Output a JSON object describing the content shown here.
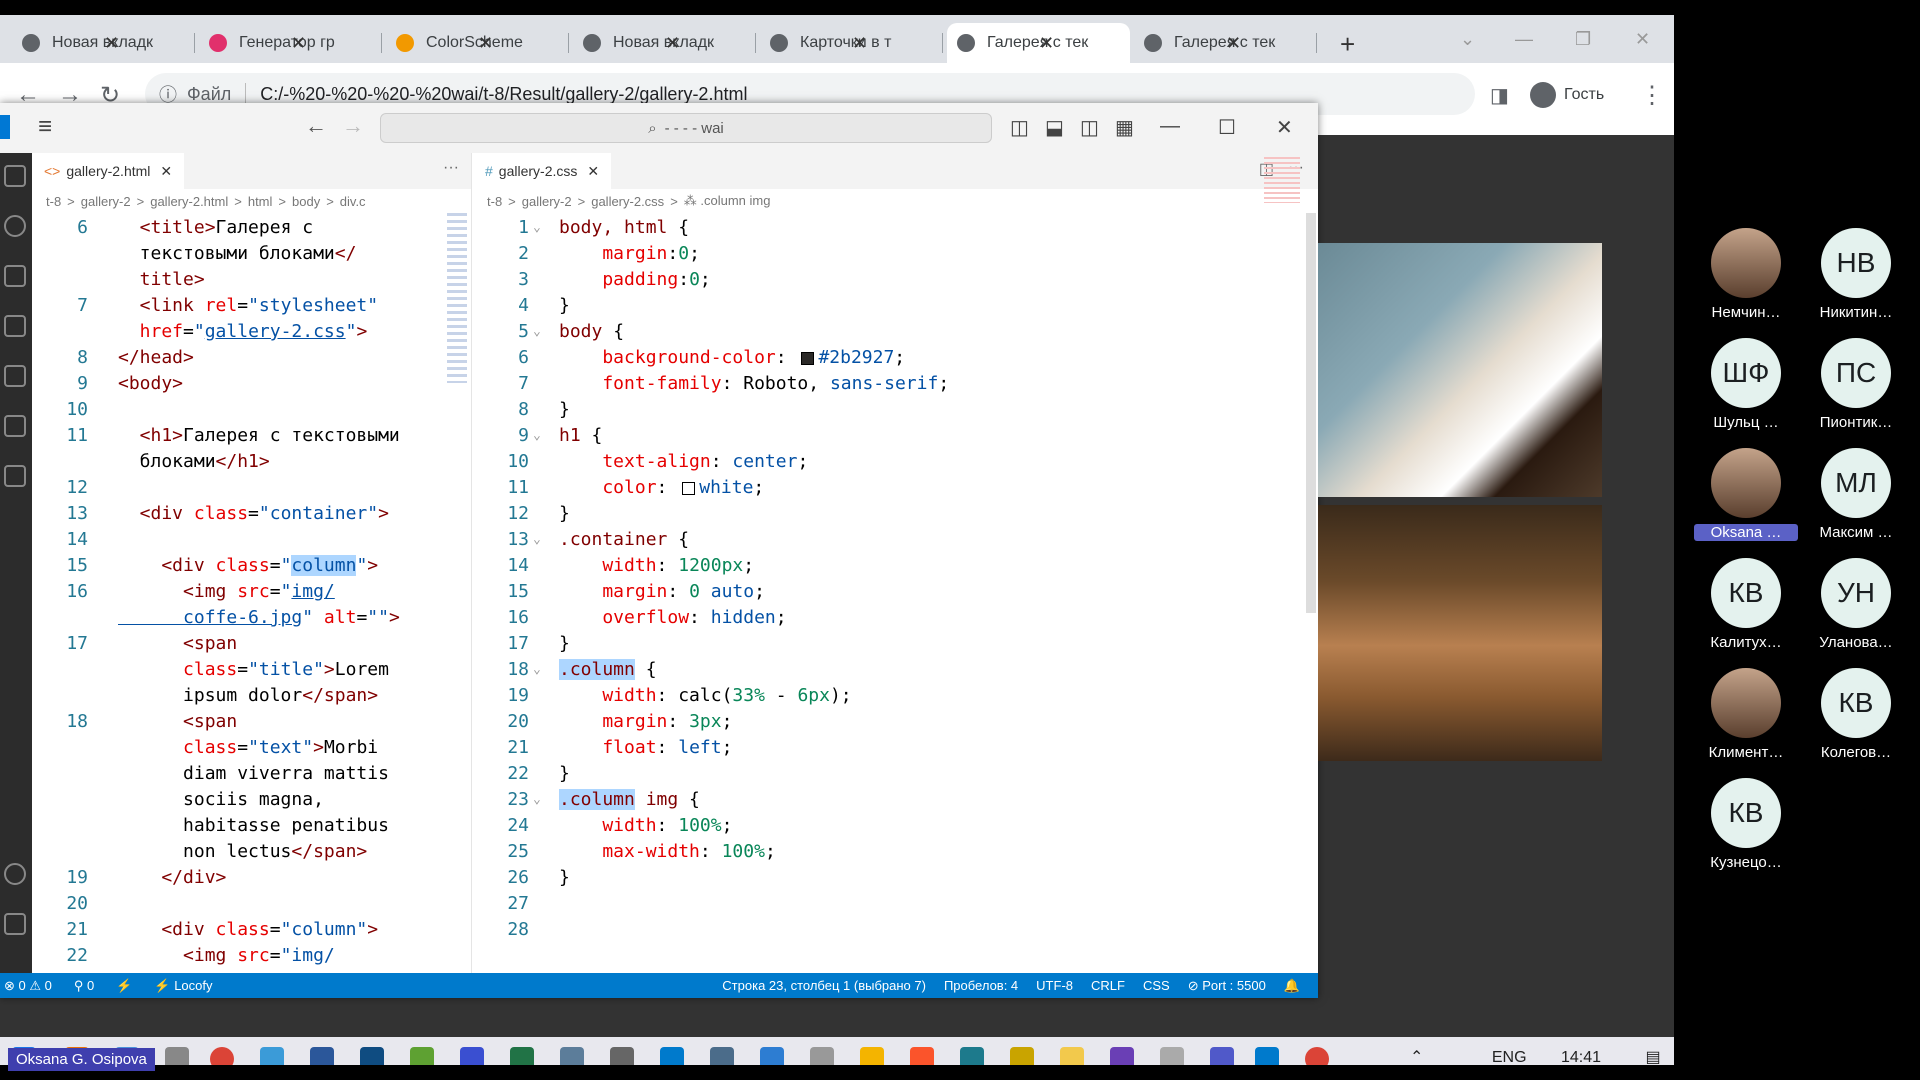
{
  "browser": {
    "tabs": [
      {
        "title": "Новая вкладк",
        "color": "#5f6368"
      },
      {
        "title": "Генератор гр",
        "color": "#e1306c"
      },
      {
        "title": "ColorScheme",
        "color": "#f29900"
      },
      {
        "title": "Новая вкладк",
        "color": "#5f6368"
      },
      {
        "title": "Карточки в т",
        "color": "#5f6368"
      },
      {
        "title": "Галерея с тек",
        "color": "#5f6368"
      },
      {
        "title": "Галерея с тек",
        "color": "#5f6368"
      }
    ],
    "active_tab": 5,
    "new_tab": "+",
    "address_label": "Файл",
    "address": "C:/-%20-%20-%20-%20wai/t-8/Result/gallery-2/gallery-2.html",
    "profile": "Гость"
  },
  "editor": {
    "search": "- - - - wai",
    "left_tab": "gallery-2.html",
    "right_tab": "gallery-2.css",
    "left_breadcrumb": [
      "t-8",
      ">",
      "gallery-2",
      ">",
      "gallery-2.html",
      ">",
      "html",
      ">",
      "body",
      ">",
      "div.c"
    ],
    "right_breadcrumb": [
      "t-8",
      ">",
      "gallery-2",
      ">",
      "gallery-2.css",
      ">",
      "⁂ .column img"
    ],
    "left_code": [
      {
        "n": "6",
        "p": [
          [
            "t-tag",
            "  <title>"
          ],
          [
            "t-text",
            "Галерея с"
          ]
        ]
      },
      {
        "n": "",
        "p": [
          [
            "t-text",
            "  текстовыми блоками"
          ],
          [
            "t-tag",
            "</"
          ]
        ]
      },
      {
        "n": "",
        "p": [
          [
            "t-tag",
            "  title>"
          ]
        ]
      },
      {
        "n": "7",
        "p": [
          [
            "t-tag",
            "  <link "
          ],
          [
            "t-attr",
            "rel"
          ],
          [
            "t-pun",
            "="
          ],
          [
            "t-str",
            "\"stylesheet\""
          ]
        ]
      },
      {
        "n": "",
        "p": [
          [
            "t-attr",
            "  href"
          ],
          [
            "t-pun",
            "="
          ],
          [
            "t-str",
            "\""
          ],
          [
            "t-str lnk",
            "gallery-2.css"
          ],
          [
            "t-str",
            "\""
          ],
          [
            "t-tag",
            ">"
          ]
        ]
      },
      {
        "n": "8",
        "p": [
          [
            "t-tag",
            "</head>"
          ]
        ]
      },
      {
        "n": "9",
        "p": [
          [
            "t-tag",
            "<body>"
          ]
        ]
      },
      {
        "n": "10",
        "p": []
      },
      {
        "n": "11",
        "p": [
          [
            "t-tag",
            "  <h1>"
          ],
          [
            "t-text",
            "Галерея с текстовыми"
          ]
        ]
      },
      {
        "n": "",
        "p": [
          [
            "t-text",
            "  блоками"
          ],
          [
            "t-tag",
            "</h1>"
          ]
        ]
      },
      {
        "n": "12",
        "p": []
      },
      {
        "n": "13",
        "p": [
          [
            "t-tag",
            "  <div "
          ],
          [
            "t-attr",
            "class"
          ],
          [
            "t-pun",
            "="
          ],
          [
            "t-str",
            "\"container\""
          ],
          [
            "t-tag",
            ">"
          ]
        ]
      },
      {
        "n": "14",
        "p": []
      },
      {
        "n": "15",
        "p": [
          [
            "t-tag",
            "    <div "
          ],
          [
            "t-attr",
            "class"
          ],
          [
            "t-pun",
            "="
          ],
          [
            "t-str",
            "\""
          ],
          [
            "t-str hl",
            "column"
          ],
          [
            "t-str",
            "\""
          ],
          [
            "t-tag",
            ">"
          ]
        ]
      },
      {
        "n": "16",
        "p": [
          [
            "t-tag",
            "      <img "
          ],
          [
            "t-attr",
            "src"
          ],
          [
            "t-pun",
            "="
          ],
          [
            "t-str",
            "\""
          ],
          [
            "t-str lnk",
            "img/"
          ]
        ]
      },
      {
        "n": "",
        "p": [
          [
            "t-str lnk",
            "      coffe-6.jpg"
          ],
          [
            "t-str",
            "\" "
          ],
          [
            "t-attr",
            "alt"
          ],
          [
            "t-pun",
            "="
          ],
          [
            "t-str",
            "\"\""
          ],
          [
            "t-tag",
            ">"
          ]
        ]
      },
      {
        "n": "17",
        "p": [
          [
            "t-tag",
            "      <span"
          ]
        ]
      },
      {
        "n": "",
        "p": [
          [
            "t-attr",
            "      class"
          ],
          [
            "t-pun",
            "="
          ],
          [
            "t-str",
            "\"title\""
          ],
          [
            "t-tag",
            ">"
          ],
          [
            "t-text",
            "Lorem"
          ]
        ]
      },
      {
        "n": "",
        "p": [
          [
            "t-text",
            "      ipsum dolor"
          ],
          [
            "t-tag",
            "</span>"
          ]
        ]
      },
      {
        "n": "18",
        "p": [
          [
            "t-tag",
            "      <span"
          ]
        ]
      },
      {
        "n": "",
        "p": [
          [
            "t-attr",
            "      class"
          ],
          [
            "t-pun",
            "="
          ],
          [
            "t-str",
            "\"text\""
          ],
          [
            "t-tag",
            ">"
          ],
          [
            "t-text",
            "Morbi"
          ]
        ]
      },
      {
        "n": "",
        "p": [
          [
            "t-text",
            "      diam viverra mattis"
          ]
        ]
      },
      {
        "n": "",
        "p": [
          [
            "t-text",
            "      sociis magna,"
          ]
        ]
      },
      {
        "n": "",
        "p": [
          [
            "t-text",
            "      habitasse penatibus"
          ]
        ]
      },
      {
        "n": "",
        "p": [
          [
            "t-text",
            "      non lectus"
          ],
          [
            "t-tag",
            "</span>"
          ]
        ]
      },
      {
        "n": "19",
        "p": [
          [
            "t-tag",
            "    </div>"
          ]
        ]
      },
      {
        "n": "20",
        "p": []
      },
      {
        "n": "21",
        "p": [
          [
            "t-tag",
            "    <div "
          ],
          [
            "t-attr",
            "class"
          ],
          [
            "t-pun",
            "="
          ],
          [
            "t-str",
            "\"column\""
          ],
          [
            "t-tag",
            ">"
          ]
        ]
      },
      {
        "n": "22",
        "p": [
          [
            "t-tag",
            "      <img "
          ],
          [
            "t-attr",
            "src"
          ],
          [
            "t-pun",
            "="
          ],
          [
            "t-str",
            "\"img/"
          ]
        ]
      }
    ],
    "right_code": [
      {
        "n": "1",
        "f": "⌄",
        "p": [
          [
            "t-sel",
            "body, html"
          ],
          [
            "t-pun",
            " {"
          ]
        ]
      },
      {
        "n": "2",
        "f": "",
        "p": [
          [
            "t-prop",
            "    margin"
          ],
          [
            "t-pun",
            ":"
          ],
          [
            "t-num",
            "0"
          ],
          [
            "t-pun",
            ";"
          ]
        ]
      },
      {
        "n": "3",
        "f": "",
        "p": [
          [
            "t-prop",
            "    padding"
          ],
          [
            "t-pun",
            ":"
          ],
          [
            "t-num",
            "0"
          ],
          [
            "t-pun",
            ";"
          ]
        ]
      },
      {
        "n": "4",
        "f": "",
        "p": [
          [
            "t-pun",
            "}"
          ]
        ]
      },
      {
        "n": "5",
        "f": "⌄",
        "p": [
          [
            "t-sel",
            "body"
          ],
          [
            "t-pun",
            " {"
          ]
        ]
      },
      {
        "n": "6",
        "f": "",
        "p": [
          [
            "t-prop",
            "    background-color"
          ],
          [
            "t-pun",
            ": "
          ],
          [
            "sw",
            "#2b2927"
          ],
          [
            "t-val",
            "#2b2927"
          ],
          [
            "t-pun",
            ";"
          ]
        ]
      },
      {
        "n": "7",
        "f": "",
        "p": [
          [
            "t-prop",
            "    font-family"
          ],
          [
            "t-pun",
            ": Roboto, "
          ],
          [
            "t-val",
            "sans-serif"
          ],
          [
            "t-pun",
            ";"
          ]
        ]
      },
      {
        "n": "8",
        "f": "",
        "p": [
          [
            "t-pun",
            "}"
          ]
        ]
      },
      {
        "n": "9",
        "f": "⌄",
        "p": [
          [
            "t-sel",
            "h1"
          ],
          [
            "t-pun",
            " {"
          ]
        ]
      },
      {
        "n": "10",
        "f": "",
        "p": [
          [
            "t-prop",
            "    text-align"
          ],
          [
            "t-pun",
            ": "
          ],
          [
            "t-val",
            "center"
          ],
          [
            "t-pun",
            ";"
          ]
        ]
      },
      {
        "n": "11",
        "f": "",
        "p": [
          [
            "t-prop",
            "    color"
          ],
          [
            "t-pun",
            ": "
          ],
          [
            "sw",
            "#ffffff"
          ],
          [
            "t-val",
            "white"
          ],
          [
            "t-pun",
            ";"
          ]
        ]
      },
      {
        "n": "12",
        "f": "",
        "p": [
          [
            "t-pun",
            "}"
          ]
        ]
      },
      {
        "n": "13",
        "f": "⌄",
        "p": [
          [
            "t-sel",
            ".container"
          ],
          [
            "t-pun",
            " {"
          ]
        ]
      },
      {
        "n": "14",
        "f": "",
        "p": [
          [
            "t-prop",
            "    width"
          ],
          [
            "t-pun",
            ": "
          ],
          [
            "t-num",
            "1200px"
          ],
          [
            "t-pun",
            ";"
          ]
        ]
      },
      {
        "n": "15",
        "f": "",
        "p": [
          [
            "t-prop",
            "    margin"
          ],
          [
            "t-pun",
            ": "
          ],
          [
            "t-num",
            "0"
          ],
          [
            "t-val",
            " auto"
          ],
          [
            "t-pun",
            ";"
          ]
        ]
      },
      {
        "n": "16",
        "f": "",
        "p": [
          [
            "t-prop",
            "    overflow"
          ],
          [
            "t-pun",
            ": "
          ],
          [
            "t-val",
            "hidden"
          ],
          [
            "t-pun",
            ";"
          ]
        ]
      },
      {
        "n": "17",
        "f": "",
        "p": [
          [
            "t-pun",
            "}"
          ]
        ]
      },
      {
        "n": "18",
        "f": "⌄",
        "p": [
          [
            "t-sel hl",
            ".column"
          ],
          [
            "t-pun",
            " {"
          ]
        ]
      },
      {
        "n": "19",
        "f": "",
        "p": [
          [
            "t-prop",
            "    width"
          ],
          [
            "t-pun",
            ": calc("
          ],
          [
            "t-num",
            "33%"
          ],
          [
            "t-pun",
            " - "
          ],
          [
            "t-num",
            "6px"
          ],
          [
            "t-pun",
            ");"
          ]
        ]
      },
      {
        "n": "20",
        "f": "",
        "p": [
          [
            "t-prop",
            "    margin"
          ],
          [
            "t-pun",
            ": "
          ],
          [
            "t-num",
            "3px"
          ],
          [
            "t-pun",
            ";"
          ]
        ]
      },
      {
        "n": "21",
        "f": "",
        "p": [
          [
            "t-prop",
            "    float"
          ],
          [
            "t-pun",
            ": "
          ],
          [
            "t-val",
            "left"
          ],
          [
            "t-pun",
            ";"
          ]
        ]
      },
      {
        "n": "22",
        "f": "",
        "p": [
          [
            "t-pun",
            "}"
          ]
        ]
      },
      {
        "n": "23",
        "f": "⌄",
        "p": [
          [
            "t-sel hl",
            ".column"
          ],
          [
            "t-sel",
            " img"
          ],
          [
            "t-pun",
            " {"
          ]
        ]
      },
      {
        "n": "24",
        "f": "",
        "p": [
          [
            "t-prop",
            "    width"
          ],
          [
            "t-pun",
            ": "
          ],
          [
            "t-num",
            "100%"
          ],
          [
            "t-pun",
            ";"
          ]
        ]
      },
      {
        "n": "25",
        "f": "",
        "p": [
          [
            "t-prop",
            "    max-width"
          ],
          [
            "t-pun",
            ": "
          ],
          [
            "t-num",
            "100%"
          ],
          [
            "t-pun",
            ";"
          ]
        ]
      },
      {
        "n": "26",
        "f": "",
        "p": [
          [
            "t-pun",
            "}"
          ]
        ]
      },
      {
        "n": "27",
        "f": "",
        "p": []
      },
      {
        "n": "28",
        "f": "",
        "p": []
      }
    ],
    "status_left": [
      "⊗ 0 ⚠ 0",
      "⚲ 0",
      "⚡",
      "⚡ Locofy"
    ],
    "status_right": [
      "Строка 23, столбец 1 (выбрано 7)",
      "Пробелов: 4",
      "UTF-8",
      "CRLF",
      "CSS",
      "⊘ Port : 5500",
      "🔔"
    ]
  },
  "taskbar": {
    "lang": "ENG",
    "time": "14:41"
  },
  "participants": [
    {
      "initials": "",
      "name": "Немчин…",
      "photo": true,
      "hi": false
    },
    {
      "initials": "НВ",
      "name": "Никитин…",
      "photo": false,
      "hi": false
    },
    {
      "initials": "ШФ",
      "name": "Шульц …",
      "photo": false,
      "hi": false
    },
    {
      "initials": "ПС",
      "name": "Пионтик…",
      "photo": false,
      "hi": false
    },
    {
      "initials": "",
      "name": "Oksana …",
      "photo": true,
      "hi": true
    },
    {
      "initials": "МЛ",
      "name": "Максим …",
      "photo": false,
      "hi": false
    },
    {
      "initials": "КВ",
      "name": "Калитух…",
      "photo": false,
      "hi": false
    },
    {
      "initials": "УН",
      "name": "Уланова…",
      "photo": false,
      "hi": false
    },
    {
      "initials": "",
      "name": "Климент…",
      "photo": true,
      "hi": false
    },
    {
      "initials": "КВ",
      "name": "Колегов…",
      "photo": false,
      "hi": false
    },
    {
      "initials": "КВ",
      "name": "Кузнецо…",
      "photo": false,
      "hi": false
    }
  ],
  "presenter": "Oksana G. Osipova"
}
